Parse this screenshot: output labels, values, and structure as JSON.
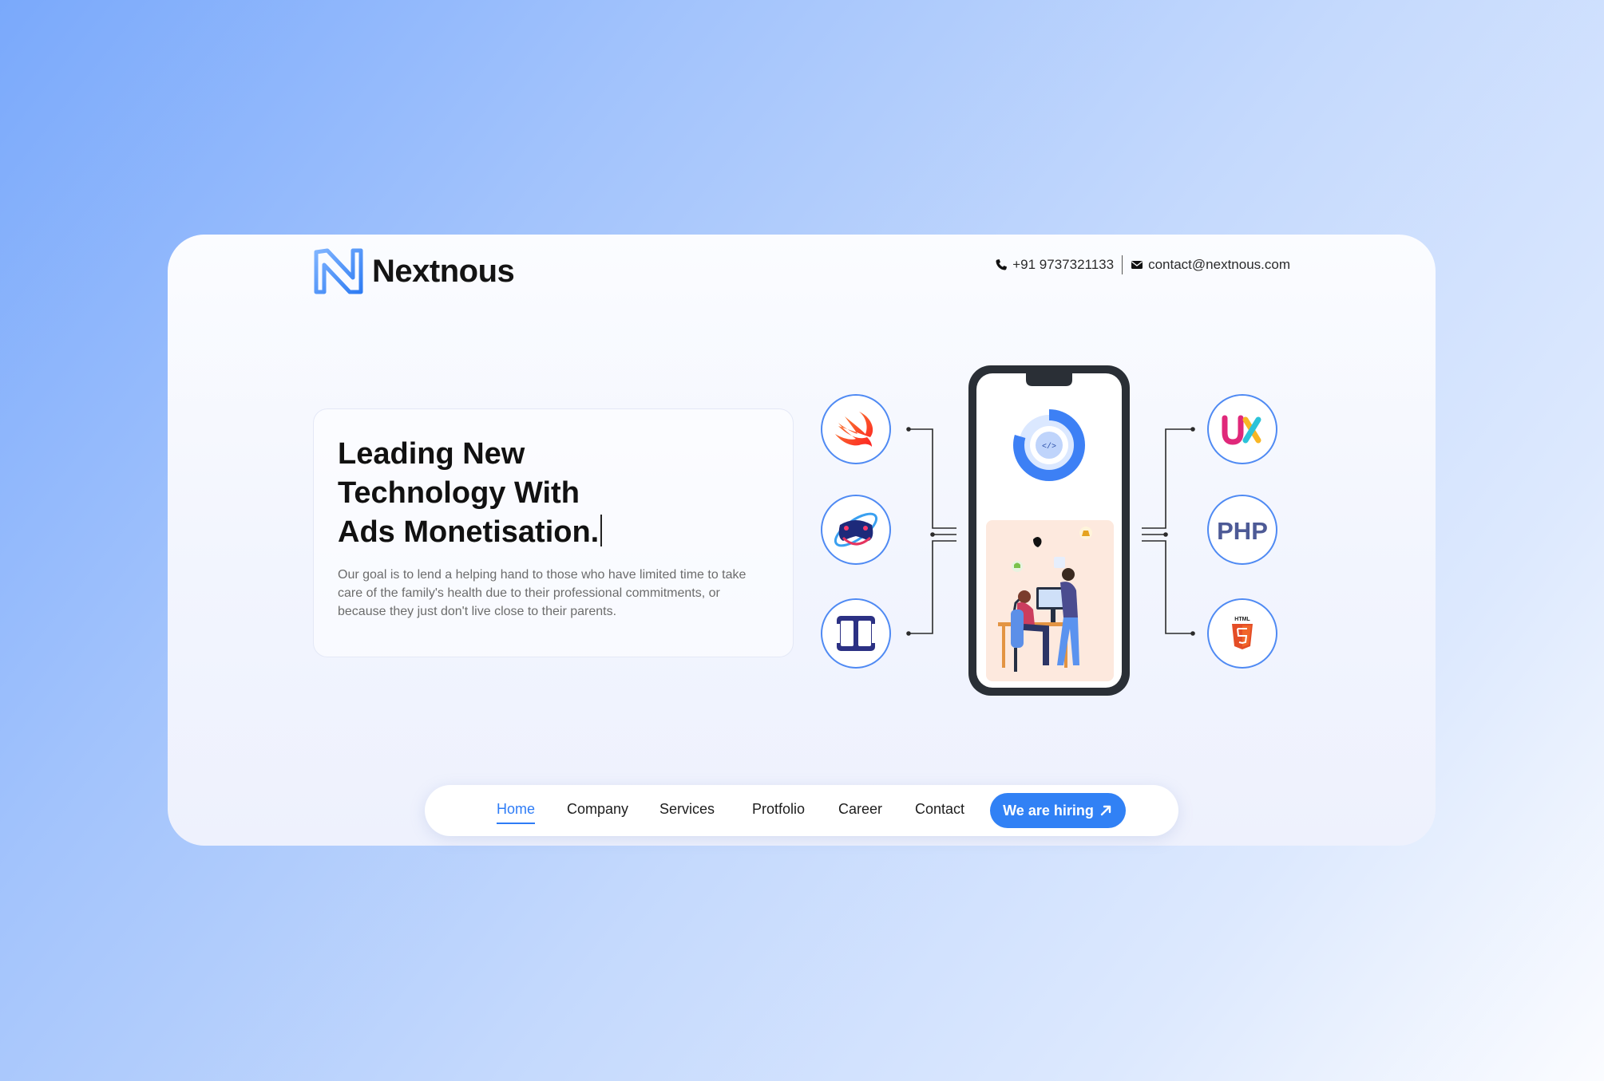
{
  "brand": {
    "name": "Nextnous"
  },
  "contact": {
    "phone": "+91 9737321133",
    "email": "contact@nextnous.com"
  },
  "hero": {
    "title_lines": [
      "Leading New",
      "Technology With",
      "Ads Monetisation."
    ],
    "description": "Our goal is to lend a helping hand to those who have limited time to take care of the family's health due to their professional commitments, or because they just don't live close to their parents."
  },
  "tech_icons": {
    "left": [
      "swift-icon",
      "game-controller-icon",
      "mobile-devices-icon"
    ],
    "right": [
      "ux-icon",
      "php-icon",
      "html5-icon"
    ],
    "labels": {
      "ux": "UX",
      "php": "PHP",
      "html": "HTML"
    }
  },
  "phone_screen": {
    "code_label": "</>"
  },
  "nav": {
    "items": [
      "Home",
      "Company",
      "Services",
      "Protfolio",
      "Career",
      "Contact"
    ],
    "active": "Home",
    "cta": "We are hiring"
  },
  "colors": {
    "accent": "#3181f5",
    "nav_active": "#2e7cf6",
    "title": "#111111",
    "body_text": "#6c6c6c",
    "circle_border": "#4f8af3",
    "phone_frame": "#2a2f36"
  }
}
